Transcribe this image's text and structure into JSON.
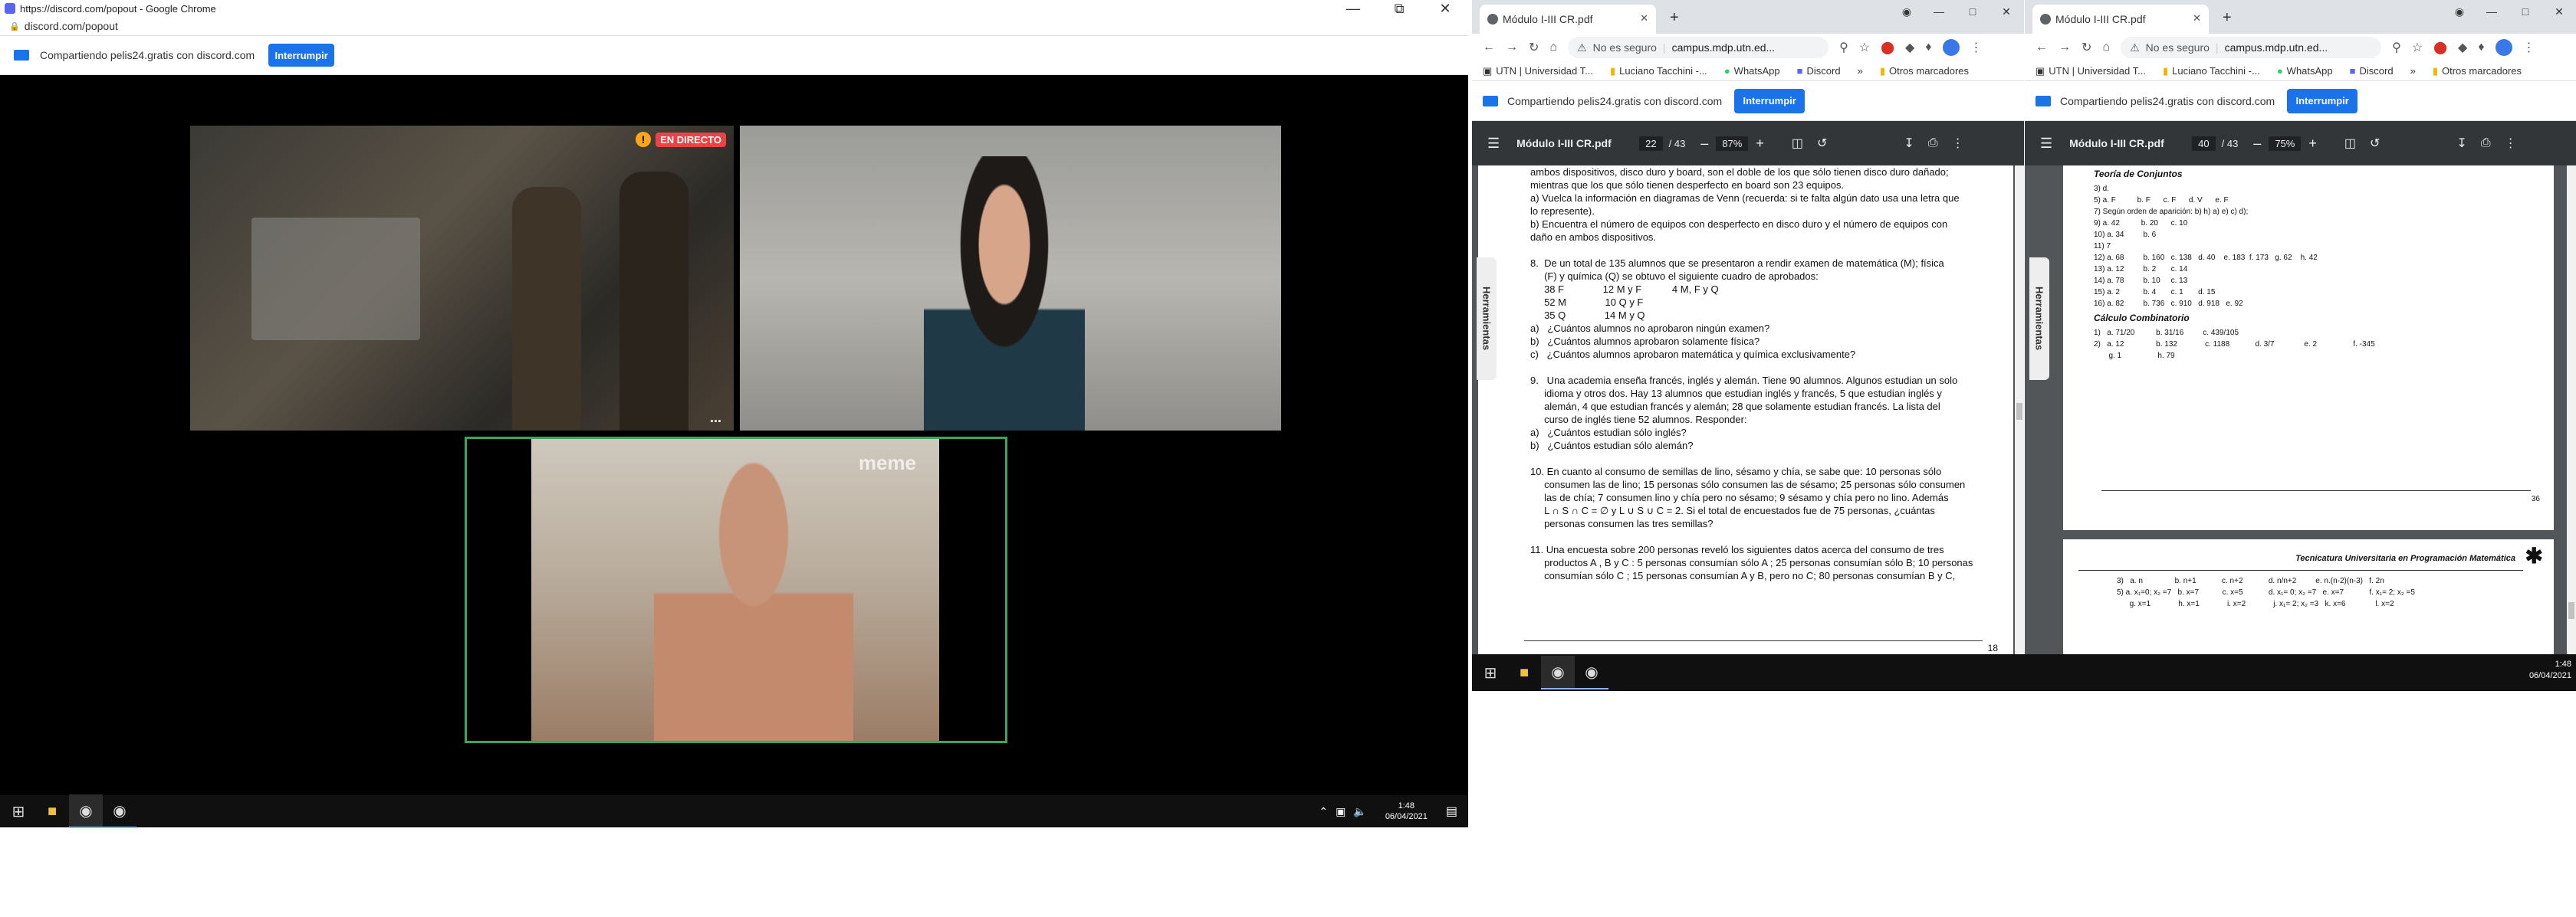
{
  "left_window": {
    "title": "https://discord.com/popout - Google Chrome",
    "url": "discord.com/popout",
    "share_text": "Compartiendo pelis24.gratis con discord.com",
    "stop_button": "Interrumpir",
    "live_badge": "EN DIRECTO",
    "more_label": "...",
    "watermark": "meme"
  },
  "taskbar_left": {
    "time": "1:48",
    "date": "06/04/2021"
  },
  "right_windows": [
    {
      "tab_title": "Módulo I-III CR.pdf",
      "not_secure": "No es seguro",
      "url": "campus.mdp.utn.ed...",
      "bookmarks": [
        "UTN | Universidad T...",
        "Luciano Tacchini -...",
        "WhatsApp",
        "Discord"
      ],
      "other_bookmarks": "Otros marcadores",
      "share_text": "Compartiendo pelis24.gratis con discord.com",
      "stop_button": "Interrumpir",
      "pdf_title": "Módulo I-III CR.pdf",
      "page_current": "22",
      "page_total": "/ 43",
      "zoom": "87%",
      "side_tab": "Herramientas"
    },
    {
      "tab_title": "Módulo I-III CR.pdf",
      "not_secure": "No es seguro",
      "url": "campus.mdp.utn.ed...",
      "bookmarks": [
        "UTN | Universidad T...",
        "Luciano Tacchini -...",
        "WhatsApp",
        "Discord"
      ],
      "other_bookmarks": "Otros marcadores",
      "share_text": "Compartiendo pelis24.gratis con discord.com",
      "stop_button": "Interrumpir",
      "pdf_title": "Módulo I-III CR.pdf",
      "page_current": "40",
      "page_total": "/ 43",
      "zoom": "75%",
      "side_tab": "Herramientas"
    }
  ],
  "pdf1": {
    "lines": [
      "ambos dispositivos, disco duro y board, son el doble de los que sólo tienen disco duro dañado;",
      "mientras que los que sólo tienen desperfecto en board son 23 equipos.",
      "a) Vuelca la información en diagramas de Venn (recuerda: si te falta algún dato usa una letra que",
      "lo represente).",
      "b) Encuentra el número de equipos con desperfecto en disco duro y el número de equipos con",
      "daño en ambos dispositivos.",
      "",
      "8.  De un total de 135 alumnos que se presentaron a rendir examen de matemática (M); física",
      "     (F) y química (Q) se obtuvo el siguiente cuadro de aprobados:",
      "     38 F              12 M y F           4 M, F y Q",
      "     52 M              10 Q y F",
      "     35 Q              14 M y Q",
      "a)   ¿Cuántos alumnos no aprobaron ningún examen?",
      "b)   ¿Cuántos alumnos aprobaron solamente física?",
      "c)   ¿Cuántos alumnos aprobaron matemática y química exclusivamente?",
      "",
      "9.   Una academia enseña francés, inglés y alemán. Tiene 90 alumnos. Algunos estudian un solo",
      "     idioma y otros dos. Hay 13 alumnos que estudian inglés y francés, 5 que estudian inglés y",
      "     alemán, 4 que estudian francés y alemán; 28 que solamente estudian francés. La lista del",
      "     curso de inglés tiene 52 alumnos. Responder:",
      "a)   ¿Cuántos estudian sólo inglés?",
      "b)   ¿Cuántos estudian sólo alemán?",
      "",
      "10. En cuanto al consumo de semillas de lino, sésamo y chía, se sabe que: 10 personas sólo",
      "     consumen las de lino; 15 personas sólo consumen las de sésamo; 25 personas sólo consumen",
      "     las de chía; 7 consumen lino y chía pero no sésamo; 9 sésamo y chía pero no lino. Además",
      "     L ∩ S ∩ C = ∅ y L ∪ S ∪ C = 2. Si el total de encuestados fue de 75 personas, ¿cuántas",
      "     personas consumen las tres semillas?",
      "",
      "11. Una encuesta sobre 200 personas reveló los siguientes datos acerca del consumo de tres",
      "     productos A , B y C : 5 personas consumían sólo A ; 25 personas consumían sólo B; 10 personas",
      "     consumían sólo C ; 15 personas consumían A y B, pero no C; 80 personas consumían B y C,"
    ],
    "page_number": "18"
  },
  "pdf2": {
    "heading1": "Teoría de Conjuntos",
    "lines1": [
      "3) d.",
      "5) a. F          b. F      c. F      d. V      e. F",
      "7) Según orden de aparición: b) h) a) e) c) d);",
      "9) a. 42          b. 20      c. 10",
      "10) a. 34         b. 6",
      "11) 7",
      "12) a. 68         b. 160   c. 138   d. 40    e. 183  f. 173   g. 62    h. 42",
      "13) a. 12         b. 2       c. 14",
      "14) a. 78         b. 10     c. 13",
      "15) a. 2           b. 4       c. 1       d. 15",
      "16) a. 82         b. 736   c. 910   d. 918   e. 92"
    ],
    "heading2": "Cálculo Combinatorio",
    "lines2": [
      "1)   a. 71/20          b. 31/16         c. 439/105",
      "2)   a. 12               b. 132             c. 1188            d. 3/7              e. 2                 f. -345",
      "       g. 1                 h. 79"
    ],
    "page_number": "36",
    "header2": "Tecnicatura Universitaria en Programación Matemática",
    "lines3": [
      "3)   a. n               b. n+1            c. n+2            d. n/n+2         e. n.(n-2)(n-3)   f. 2n",
      "5) a. x₁=0; x₂ =7   b. x=7           c. x=5            d. x₁= 0; x₂ =7   e. x=7            f. x₁= 2; x₂ =5",
      "      g. x=1             h. x=1             i. x=2             j. x₁= 2; x₂ =3   k. x=6              l. x=2"
    ]
  },
  "taskbar_right": {
    "time": "1:48",
    "date": "06/04/2021"
  },
  "colors": {
    "accent": "#1a73e8",
    "live_red": "#ed4245",
    "discord_bg": "#000000",
    "speaking_green": "#3ba55c",
    "pdf_toolbar": "#323639",
    "pdf_bg": "#525659"
  }
}
